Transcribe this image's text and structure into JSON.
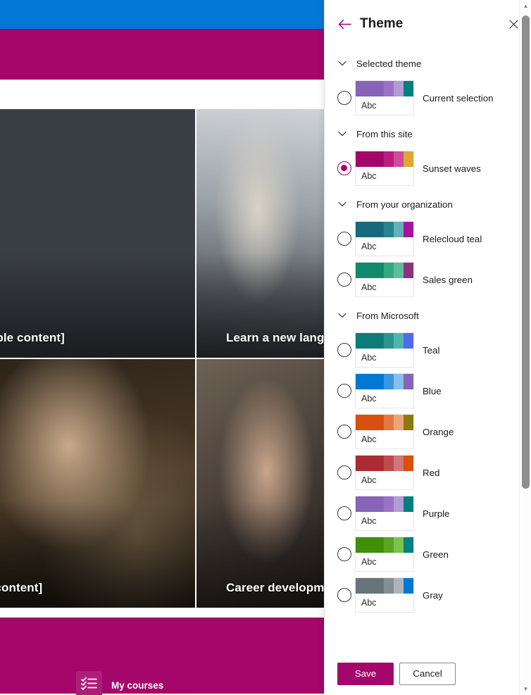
{
  "background_page": {
    "cards": [
      {
        "title": "s [Sample content]"
      },
      {
        "title": "Learn a new lang"
      },
      {
        "title": "ample content]"
      },
      {
        "title": "Career developm"
      }
    ],
    "footer": {
      "icon": "checklist-icon",
      "label": "My courses"
    },
    "colors": {
      "top_band": "#0078d4",
      "hero_band": "#a4066a",
      "footer_band": "#a4066a"
    }
  },
  "panel": {
    "title": "Theme",
    "back_icon": "back-arrow-icon",
    "close_icon": "close-icon",
    "accent_color": "#a4066a",
    "swatch_sample_text": "Abc",
    "sections": [
      {
        "label": "Selected theme",
        "expanded": true,
        "themes": [
          {
            "name": "Current selection",
            "selected": false,
            "colors": [
              "#8764b8",
              "#9a72c4",
              "#b49ad6",
              "#00807f"
            ]
          }
        ]
      },
      {
        "label": "From this site",
        "expanded": true,
        "themes": [
          {
            "name": "Sunset waves",
            "selected": true,
            "colors": [
              "#a4066a",
              "#bb1d7f",
              "#cf4a9b",
              "#dda731"
            ]
          }
        ]
      },
      {
        "label": "From your organization",
        "expanded": true,
        "themes": [
          {
            "name": "Relecloud teal",
            "selected": false,
            "colors": [
              "#19697c",
              "#28838f",
              "#62b0b8",
              "#a3179f"
            ]
          },
          {
            "name": "Sales green",
            "selected": false,
            "colors": [
              "#108a6c",
              "#35a87f",
              "#5cbd9c",
              "#8c3080"
            ]
          }
        ]
      },
      {
        "label": "From Microsoft",
        "expanded": true,
        "themes": [
          {
            "name": "Teal",
            "selected": false,
            "colors": [
              "#0d7c78",
              "#2a958f",
              "#4db6ae",
              "#4f6bed"
            ]
          },
          {
            "name": "Blue",
            "selected": false,
            "colors": [
              "#0078d4",
              "#3a96e0",
              "#86bfec",
              "#8764b8"
            ]
          },
          {
            "name": "Orange",
            "selected": false,
            "colors": [
              "#d8500f",
              "#e27a3f",
              "#eda47a",
              "#8a7a0a"
            ]
          },
          {
            "name": "Red",
            "selected": false,
            "colors": [
              "#ab2b33",
              "#c0494c",
              "#d1767a",
              "#d8500f"
            ]
          },
          {
            "name": "Purple",
            "selected": false,
            "colors": [
              "#8764b8",
              "#9a72c4",
              "#b49ad6",
              "#00807f"
            ]
          },
          {
            "name": "Green",
            "selected": false,
            "colors": [
              "#3f8f0b",
              "#5aa521",
              "#7dc24a",
              "#00807f"
            ]
          },
          {
            "name": "Gray",
            "selected": false,
            "colors": [
              "#69737a",
              "#838d94",
              "#adb5bb",
              "#0078d4"
            ]
          }
        ]
      }
    ],
    "footer": {
      "save_label": "Save",
      "cancel_label": "Cancel"
    },
    "scrollbar": {
      "up_arrow_icon": "scroll-up-icon",
      "down_arrow_icon": "scroll-down-icon"
    }
  }
}
